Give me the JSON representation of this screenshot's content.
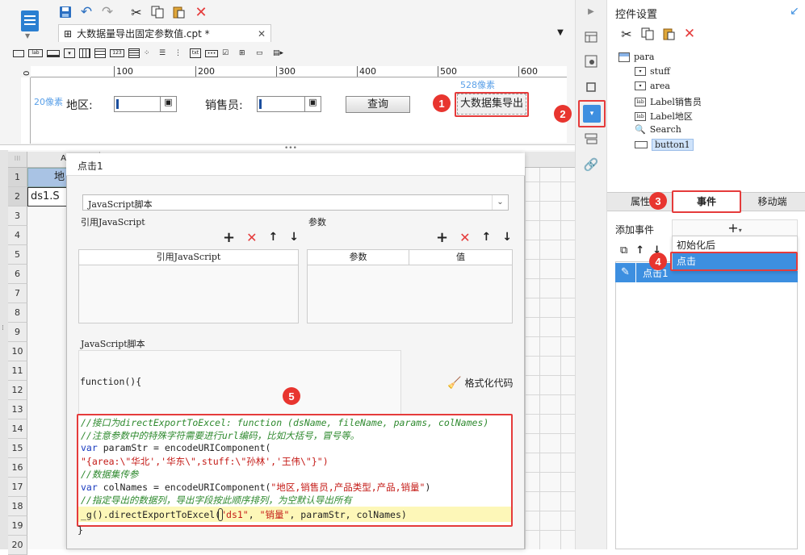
{
  "tab": {
    "title": "大数据量导出固定参数值.cpt *"
  },
  "ruler": {
    "marks": [
      "0",
      "100",
      "200",
      "300",
      "400",
      "500",
      "600"
    ]
  },
  "design": {
    "region_label": "地区:",
    "salesman_label": "销售员:",
    "query_label": "查询",
    "export_label": "大数据集导出",
    "size_left": "20像素",
    "size_top": "528像素"
  },
  "badges": [
    "1",
    "2",
    "3",
    "4",
    "5"
  ],
  "sheet": {
    "col_a": "A",
    "cell_a1": "地",
    "cell_a2": "ds1.S",
    "rows": [
      "1",
      "2",
      "3",
      "4",
      "5",
      "6",
      "7",
      "8",
      "9",
      "10",
      "11",
      "12",
      "13",
      "14",
      "15",
      "16",
      "17",
      "18",
      "19",
      "20"
    ]
  },
  "dialog": {
    "title": "点击1",
    "script_type": "JavaScript脚本",
    "ref_js_label": "引用JavaScript",
    "params_label": "参数",
    "ref_js_header": "引用JavaScript",
    "params_header": "参数",
    "value_header": "值",
    "js_script_label": "JavaScript脚本",
    "fn_open": "function(){",
    "fn_close": "}",
    "format_label": "格式化代码",
    "code": {
      "l1": "//接口为directExportToExcel: function (dsName, fileName, params, colNames)",
      "l2": "//注意参数中的特殊字符需要进行url编码，比如大括号，冒号等。",
      "l3_kw": "var",
      "l3": " paramStr = encodeURIComponent(",
      "l4": "\"{area:\\\"华北','华东\\\",stuff:\\\"孙林','王伟\\\"}\")",
      "l5": "//数据集传参",
      "l6_kw": "var",
      "l6a": " colNames = encodeURIComponent(",
      "l6s": "\"地区,销售员,产品类型,产品,销量\"",
      "l6b": ")",
      "l7": "//指定导出的数据列，导出字段按此顺序排列，为空默认导出所有",
      "l8a": "_g().directExportToExcel(",
      "l8s1": "\"ds1\"",
      "l8b": ", ",
      "l8s2": "\"销量\"",
      "l8c": ", paramStr, colNames)"
    }
  },
  "panel": {
    "title": "控件设置",
    "tree": {
      "root": "para",
      "items": [
        "stuff",
        "area",
        "Label销售员",
        "Label地区",
        "Search",
        "button1"
      ]
    },
    "tabs": [
      "属性",
      "事件",
      "移动端"
    ],
    "add_event": "添加事件",
    "menu": [
      "初始化后",
      "点击"
    ],
    "event_item": "点击1"
  },
  "colors": {
    "accent": "#3d8fe0",
    "badge": "#e8352f",
    "highlight": "#fdf7b8"
  }
}
